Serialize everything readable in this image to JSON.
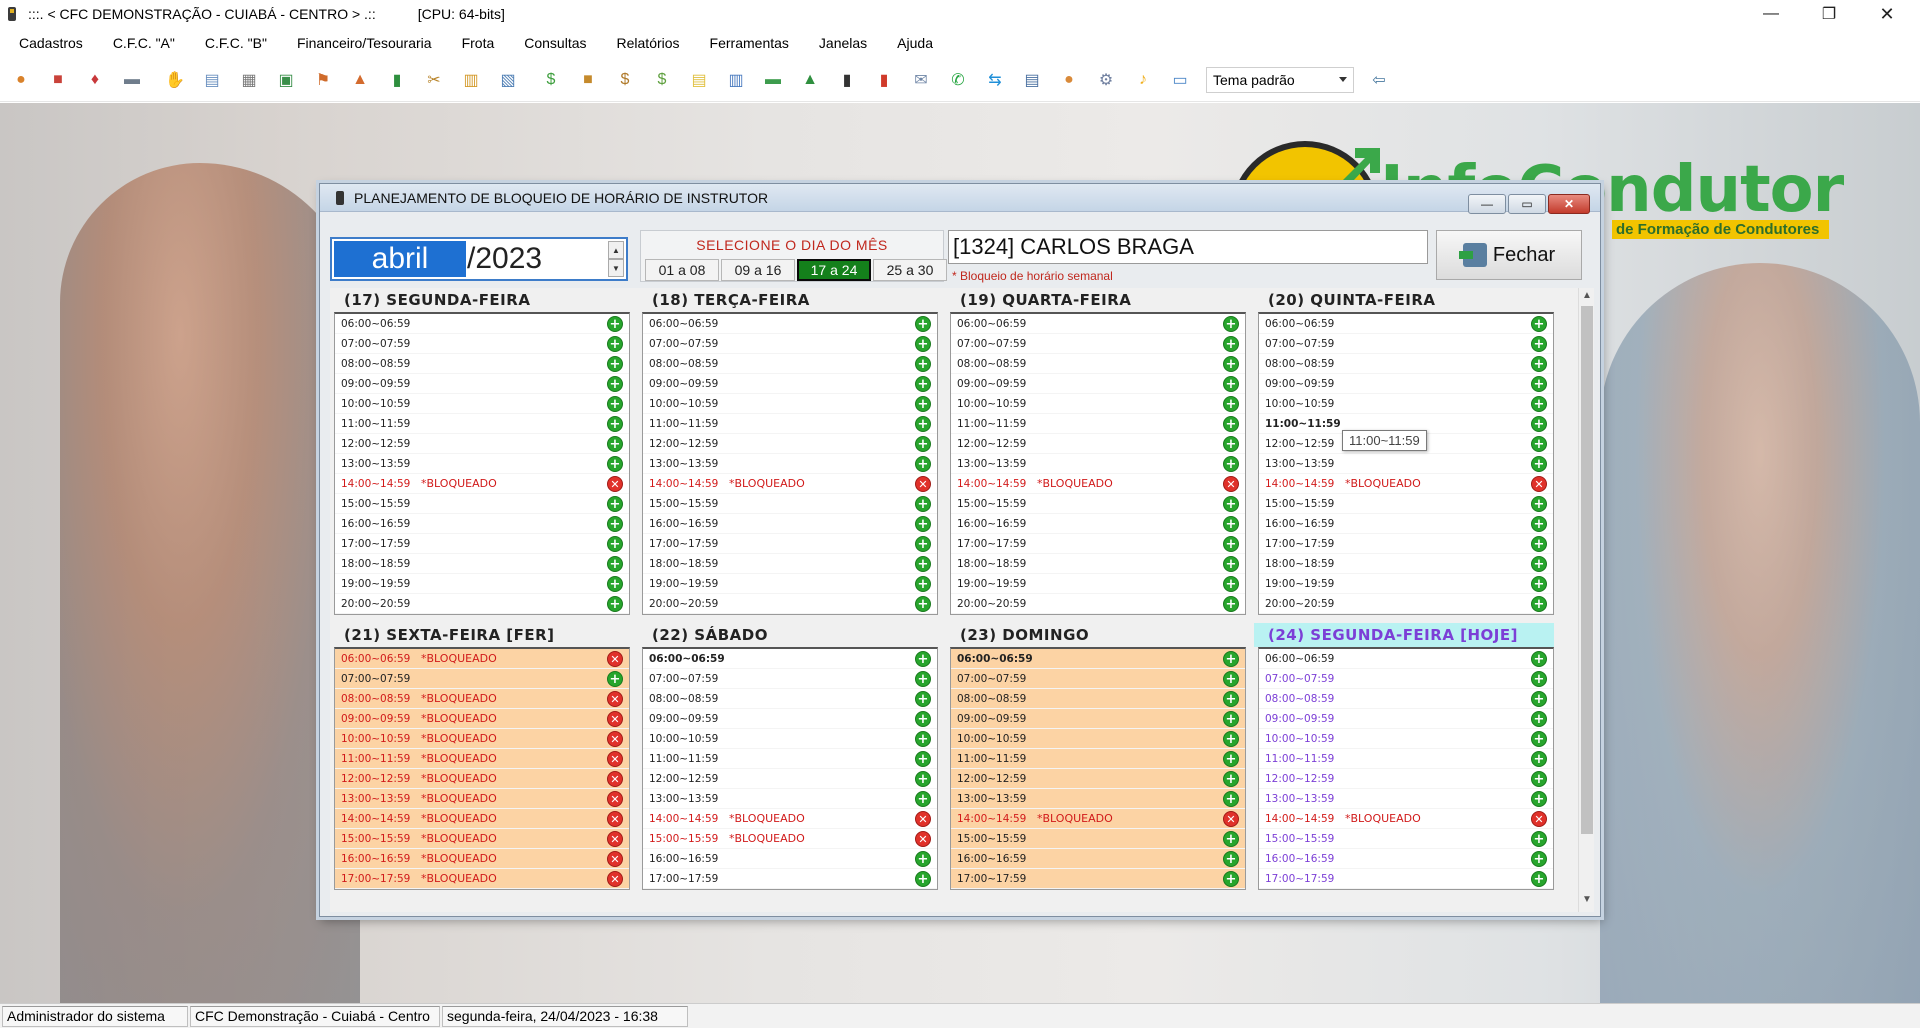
{
  "app": {
    "title": ":::. < CFC DEMONSTRAÇÃO - CUIABÁ - CENTRO > .::",
    "cpu": "[CPU: 64-bits]",
    "controls": {
      "min": "—",
      "max": "❐",
      "close": "✕"
    }
  },
  "menu": [
    "Cadastros",
    "C.F.C. \"A\"",
    "C.F.C. \"B\"",
    "Financeiro/Tesouraria",
    "Frota",
    "Consultas",
    "Relatórios",
    "Ferramentas",
    "Janelas",
    "Ajuda"
  ],
  "toolbar": {
    "icons": [
      "users-icon",
      "cash-register-icon",
      "gift-icon",
      "car-icon",
      "handshake-icon",
      "document-icon",
      "printer-icon",
      "calendar-icon",
      "instructor-icon",
      "upload-icon",
      "book-icon",
      "tools-icon",
      "clipboard-icon",
      "id-card-icon",
      "money-icon",
      "box-icon",
      "money-bag-icon",
      "money-bag-plus-icon",
      "notes-icon",
      "forms-icon",
      "cash-icon",
      "chart-icon",
      "boleto-icon",
      "extinguisher-icon",
      "email-icon",
      "whatsapp-icon",
      "teamviewer-icon",
      "list-icon",
      "people-icon",
      "gears-icon",
      "bell-icon",
      "chat-icon"
    ],
    "theme": "Tema padrão",
    "exit_icon": "exit-icon"
  },
  "logo": {
    "text": "InfoCondutor",
    "subtitle": "de Formação de Condutores"
  },
  "dialog": {
    "title": "PLANEJAMENTO DE BLOQUEIO DE HORÁRIO DE INSTRUTOR",
    "month": "abril",
    "year": "/2023",
    "select_label": "SELECIONE O DIA DO MÊS",
    "ranges": [
      "01 a 08",
      "09 a 16",
      "17 a 24",
      "25 a 30"
    ],
    "active_range": 2,
    "instructor": "[1324] CARLOS BRAGA",
    "note": "* Bloqueio de horário semanal",
    "close_label": "Fechar",
    "tooltip": "11:00~11:59",
    "days": [
      {
        "title": "(17) SEGUNDA-FEIRA",
        "slots": [
          {
            "t": "06:00~06:59"
          },
          {
            "t": "07:00~07:59"
          },
          {
            "t": "08:00~08:59"
          },
          {
            "t": "09:00~09:59"
          },
          {
            "t": "10:00~10:59"
          },
          {
            "t": "11:00~11:59"
          },
          {
            "t": "12:00~12:59"
          },
          {
            "t": "13:00~13:59"
          },
          {
            "t": "14:00~14:59",
            "s": "*BLOQUEADO"
          },
          {
            "t": "15:00~15:59"
          },
          {
            "t": "16:00~16:59"
          },
          {
            "t": "17:00~17:59"
          },
          {
            "t": "18:00~18:59"
          },
          {
            "t": "19:00~19:59"
          },
          {
            "t": "20:00~20:59"
          }
        ]
      },
      {
        "title": "(18) TERÇA-FEIRA",
        "slots": [
          {
            "t": "06:00~06:59"
          },
          {
            "t": "07:00~07:59"
          },
          {
            "t": "08:00~08:59"
          },
          {
            "t": "09:00~09:59"
          },
          {
            "t": "10:00~10:59"
          },
          {
            "t": "11:00~11:59"
          },
          {
            "t": "12:00~12:59"
          },
          {
            "t": "13:00~13:59"
          },
          {
            "t": "14:00~14:59",
            "s": "*BLOQUEADO"
          },
          {
            "t": "15:00~15:59"
          },
          {
            "t": "16:00~16:59"
          },
          {
            "t": "17:00~17:59"
          },
          {
            "t": "18:00~18:59"
          },
          {
            "t": "19:00~19:59"
          },
          {
            "t": "20:00~20:59"
          }
        ]
      },
      {
        "title": "(19) QUARTA-FEIRA",
        "slots": [
          {
            "t": "06:00~06:59"
          },
          {
            "t": "07:00~07:59"
          },
          {
            "t": "08:00~08:59"
          },
          {
            "t": "09:00~09:59"
          },
          {
            "t": "10:00~10:59"
          },
          {
            "t": "11:00~11:59"
          },
          {
            "t": "12:00~12:59"
          },
          {
            "t": "13:00~13:59"
          },
          {
            "t": "14:00~14:59",
            "s": "*BLOQUEADO"
          },
          {
            "t": "15:00~15:59"
          },
          {
            "t": "16:00~16:59"
          },
          {
            "t": "17:00~17:59"
          },
          {
            "t": "18:00~18:59"
          },
          {
            "t": "19:00~19:59"
          },
          {
            "t": "20:00~20:59"
          }
        ]
      },
      {
        "title": "(20) QUINTA-FEIRA",
        "slots": [
          {
            "t": "06:00~06:59"
          },
          {
            "t": "07:00~07:59"
          },
          {
            "t": "08:00~08:59"
          },
          {
            "t": "09:00~09:59"
          },
          {
            "t": "10:00~10:59"
          },
          {
            "t": "11:00~11:59",
            "b": true
          },
          {
            "t": "12:00~12:59"
          },
          {
            "t": "13:00~13:59"
          },
          {
            "t": "14:00~14:59",
            "s": "*BLOQUEADO"
          },
          {
            "t": "15:00~15:59"
          },
          {
            "t": "16:00~16:59"
          },
          {
            "t": "17:00~17:59"
          },
          {
            "t": "18:00~18:59"
          },
          {
            "t": "19:00~19:59"
          },
          {
            "t": "20:00~20:59"
          }
        ]
      },
      {
        "title": "(21) SEXTA-FEIRA [FER]",
        "orange": true,
        "slots": [
          {
            "t": "06:00~06:59",
            "s": "*BLOQUEADO"
          },
          {
            "t": "07:00~07:59"
          },
          {
            "t": "08:00~08:59",
            "s": "*BLOQUEADO"
          },
          {
            "t": "09:00~09:59",
            "s": "*BLOQUEADO"
          },
          {
            "t": "10:00~10:59",
            "s": "*BLOQUEADO"
          },
          {
            "t": "11:00~11:59",
            "s": "*BLOQUEADO"
          },
          {
            "t": "12:00~12:59",
            "s": "*BLOQUEADO"
          },
          {
            "t": "13:00~13:59",
            "s": "*BLOQUEADO"
          },
          {
            "t": "14:00~14:59",
            "s": "*BLOQUEADO"
          },
          {
            "t": "15:00~15:59",
            "s": "*BLOQUEADO"
          },
          {
            "t": "16:00~16:59",
            "s": "*BLOQUEADO"
          },
          {
            "t": "17:00~17:59",
            "s": "*BLOQUEADO"
          }
        ]
      },
      {
        "title": "(22) SÁBADO",
        "slots": [
          {
            "t": "06:00~06:59",
            "b": true
          },
          {
            "t": "07:00~07:59"
          },
          {
            "t": "08:00~08:59"
          },
          {
            "t": "09:00~09:59"
          },
          {
            "t": "10:00~10:59"
          },
          {
            "t": "11:00~11:59"
          },
          {
            "t": "12:00~12:59"
          },
          {
            "t": "13:00~13:59"
          },
          {
            "t": "14:00~14:59",
            "s": "*BLOQUEADO"
          },
          {
            "t": "15:00~15:59",
            "s": "*BLOQUEADO"
          },
          {
            "t": "16:00~16:59"
          },
          {
            "t": "17:00~17:59"
          }
        ]
      },
      {
        "title": "(23) DOMINGO",
        "orange": true,
        "slots": [
          {
            "t": "06:00~06:59",
            "b": true
          },
          {
            "t": "07:00~07:59"
          },
          {
            "t": "08:00~08:59"
          },
          {
            "t": "09:00~09:59"
          },
          {
            "t": "10:00~10:59"
          },
          {
            "t": "11:00~11:59"
          },
          {
            "t": "12:00~12:59"
          },
          {
            "t": "13:00~13:59"
          },
          {
            "t": "14:00~14:59",
            "s": "*BLOQUEADO"
          },
          {
            "t": "15:00~15:59"
          },
          {
            "t": "16:00~16:59"
          },
          {
            "t": "17:00~17:59"
          }
        ]
      },
      {
        "title": "(24) SEGUNDA-FEIRA [HOJE]",
        "today": true,
        "slots": [
          {
            "t": "06:00~06:59",
            "plain": true
          },
          {
            "t": "07:00~07:59"
          },
          {
            "t": "08:00~08:59"
          },
          {
            "t": "09:00~09:59"
          },
          {
            "t": "10:00~10:59"
          },
          {
            "t": "11:00~11:59"
          },
          {
            "t": "12:00~12:59"
          },
          {
            "t": "13:00~13:59"
          },
          {
            "t": "14:00~14:59",
            "s": "*BLOQUEADO"
          },
          {
            "t": "15:00~15:59"
          },
          {
            "t": "16:00~16:59"
          },
          {
            "t": "17:00~17:59"
          }
        ]
      }
    ]
  },
  "status": {
    "user": "Administrador do sistema",
    "company": "CFC Demonstração - Cuiabá - Centro",
    "datetime": "segunda-feira, 24/04/2023 - 16:38"
  }
}
